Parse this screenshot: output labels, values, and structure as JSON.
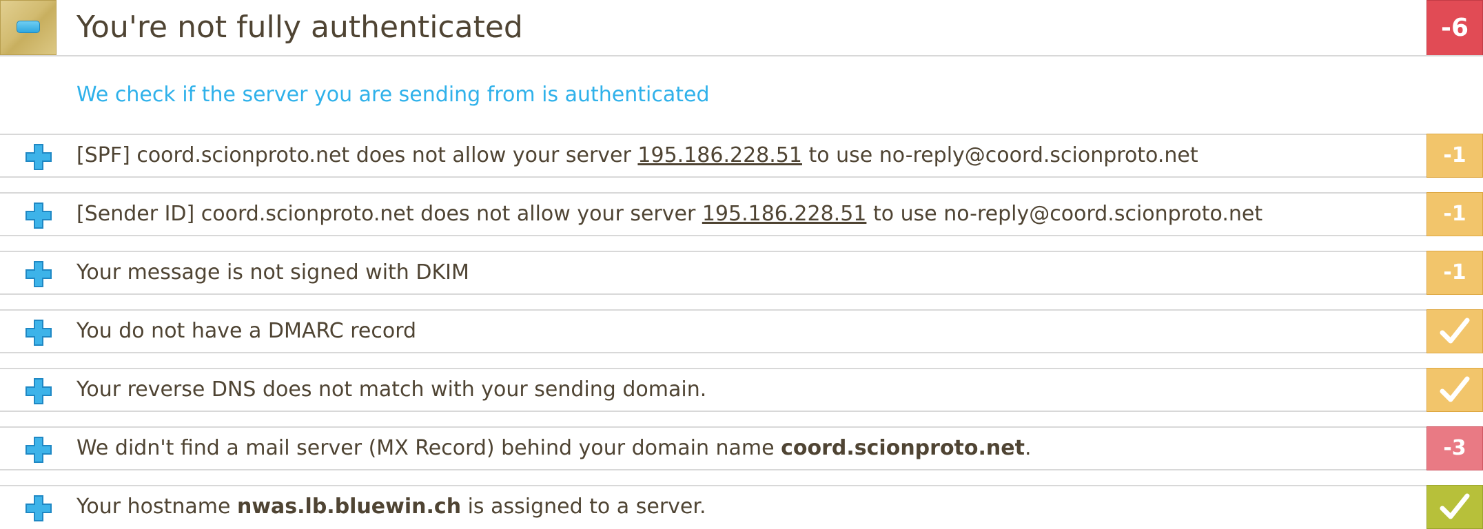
{
  "section": {
    "title": "You're not fully authenticated",
    "total_score": "-6",
    "subtitle": "We check if the server you are sending from is authenticated",
    "collapse_icon": "minus-icon"
  },
  "colors": {
    "subtitle": "#2fb1ea",
    "score_bad": "#e14b55",
    "score_warn": "#f2c56b",
    "score_good": "#b7c03a"
  },
  "checks": [
    {
      "pre": "[SPF] coord.scionproto.net does not allow your server ",
      "ip": "195.186.228.51",
      "post": " to use no-reply@coord.scionproto.net",
      "score": "-1",
      "status": "warn"
    },
    {
      "pre": "[Sender ID] coord.scionproto.net does not allow your server ",
      "ip": "195.186.228.51",
      "post": " to use no-reply@coord.scionproto.net",
      "score": "-1",
      "status": "warn"
    },
    {
      "text": "Your message is not signed with DKIM",
      "score": "-1",
      "status": "warn"
    },
    {
      "text": "You do not have a DMARC record",
      "score_icon": "checkmark-icon",
      "status": "ok"
    },
    {
      "text": "Your reverse DNS does not match with your sending domain.",
      "score_icon": "checkmark-icon",
      "status": "ok"
    },
    {
      "pre": "We didn't find a mail server (MX Record) behind your domain name ",
      "bold": "coord.scionproto.net",
      "post": ".",
      "score": "-3",
      "status": "bad"
    },
    {
      "pre": "Your hostname ",
      "bold": "nwas.lb.bluewin.ch",
      "post": " is assigned to a server.",
      "score_icon": "checkmark-icon",
      "status": "good"
    }
  ]
}
